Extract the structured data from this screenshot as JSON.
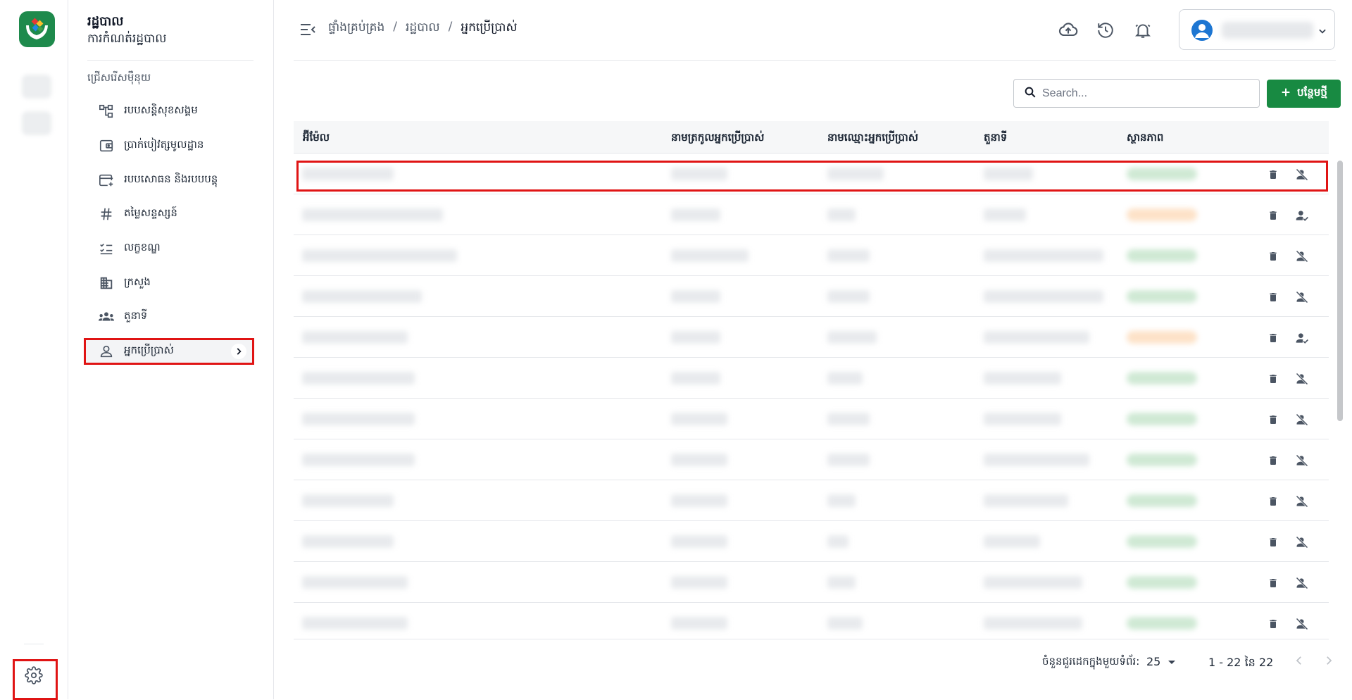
{
  "sidebar": {
    "title": "រដ្ឋបាល",
    "subtitle": "ការកំណត់រដ្ឋបាល",
    "section_label": "ជ្រើសរើសម៉ឺនុយ",
    "items": [
      {
        "label": "របបសន្តិសុខសង្គម",
        "icon": "org-tree-icon"
      },
      {
        "label": "ប្រាក់បៀវត្សមូលដ្ឋាន",
        "icon": "wallet-icon"
      },
      {
        "label": "របបសោធន និងរបបបន្តុ",
        "icon": "card-add-icon"
      },
      {
        "label": "តម្លៃសន្ទស្សន៍",
        "icon": "hash-icon"
      },
      {
        "label": "លក្ខខណ្ឌ",
        "icon": "checklist-icon"
      },
      {
        "label": "ក្រសួង",
        "icon": "building-icon"
      },
      {
        "label": "តួនាទី",
        "icon": "group-icon"
      },
      {
        "label": "អ្នកប្រើប្រាស់",
        "icon": "user-icon",
        "active": true
      }
    ]
  },
  "breadcrumb": [
    "ផ្ទាំងគ្រប់គ្រង",
    "រដ្ឋបាល",
    "អ្នកប្រើប្រាស់"
  ],
  "search": {
    "placeholder": "Search..."
  },
  "add_button": {
    "label": "បន្ថែមថ្មី",
    "icon": "plus-icon"
  },
  "table": {
    "columns": [
      "អ៊ីម៉ែល",
      "នាមត្រកូលអ្នកប្រើប្រាស់",
      "នាមឈ្មោះអ្នកប្រើប្រាស់",
      "តួនាទី",
      "ស្ថានភាព"
    ],
    "rows": [
      {
        "status": "active",
        "action": "deactivate-user-icon"
      },
      {
        "status": "inactive",
        "action": "activate-user-icon"
      },
      {
        "status": "active",
        "action": "deactivate-user-icon"
      },
      {
        "status": "active",
        "action": "deactivate-user-icon"
      },
      {
        "status": "inactive",
        "action": "activate-user-icon"
      },
      {
        "status": "active",
        "action": "deactivate-user-icon"
      },
      {
        "status": "active",
        "action": "deactivate-user-icon"
      },
      {
        "status": "active",
        "action": "deactivate-user-icon"
      },
      {
        "status": "active",
        "action": "deactivate-user-icon"
      },
      {
        "status": "active",
        "action": "deactivate-user-icon"
      },
      {
        "status": "active",
        "action": "deactivate-user-icon"
      },
      {
        "status": "active",
        "action": "deactivate-user-icon"
      }
    ]
  },
  "pagination": {
    "rows_per_page_label": "ចំនួនជួរដេកក្នុងមួយទំព័រ:",
    "rows_per_page": "25",
    "range": "1 - 22 នៃ 22"
  },
  "colors": {
    "brand": "#1e8a4c",
    "primary_button": "#188a42",
    "highlight": "#e01414",
    "status_active": "#cfe9d4",
    "status_inactive": "#fde2c8"
  }
}
